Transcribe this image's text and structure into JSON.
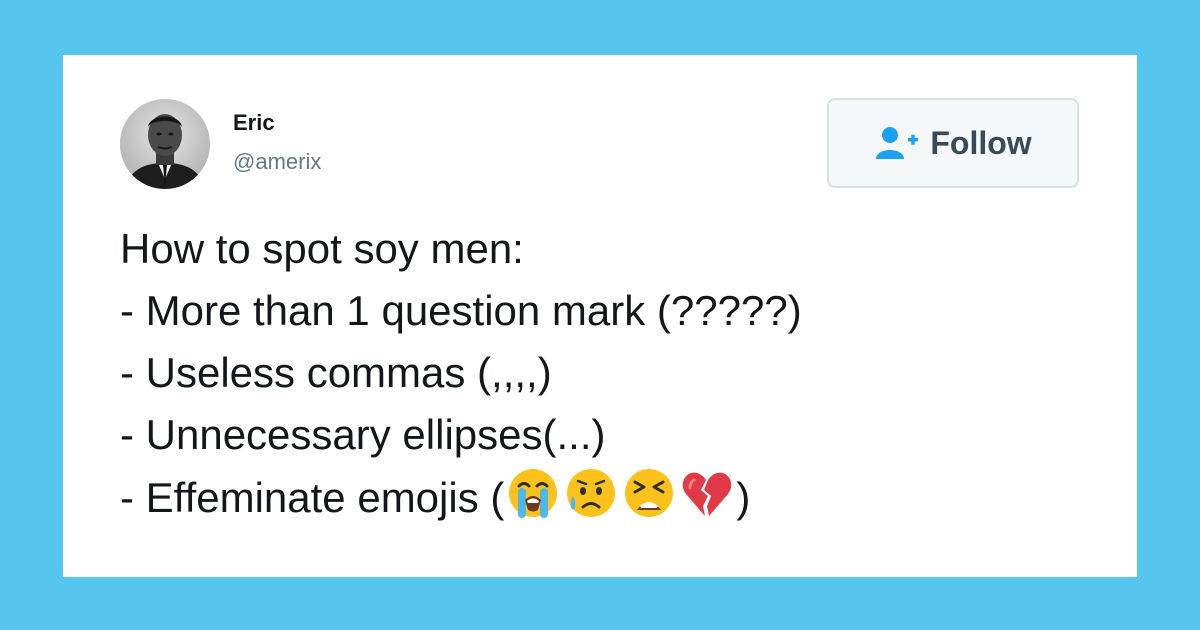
{
  "user": {
    "name": "Eric",
    "handle": "@amerix"
  },
  "follow_button": {
    "label": "Follow",
    "icon": "add-user-icon"
  },
  "tweet": {
    "line1": "How to spot soy men:",
    "line2": "- More than 1 question mark (?????)",
    "line3": "- Useless commas (,,,,)",
    "line4": "- Unnecessary ellipses(...)",
    "line5_prefix": "- Effeminate emojis (",
    "line5_suffix": ")",
    "emojis": [
      "loudly-crying-face",
      "sad-but-relieved-face",
      "tired-face",
      "broken-heart"
    ]
  },
  "colors": {
    "background": "#56c6ee",
    "card": "#ffffff",
    "text": "#14171a",
    "handle": "#657786",
    "follow_icon": "#1da1f2"
  }
}
